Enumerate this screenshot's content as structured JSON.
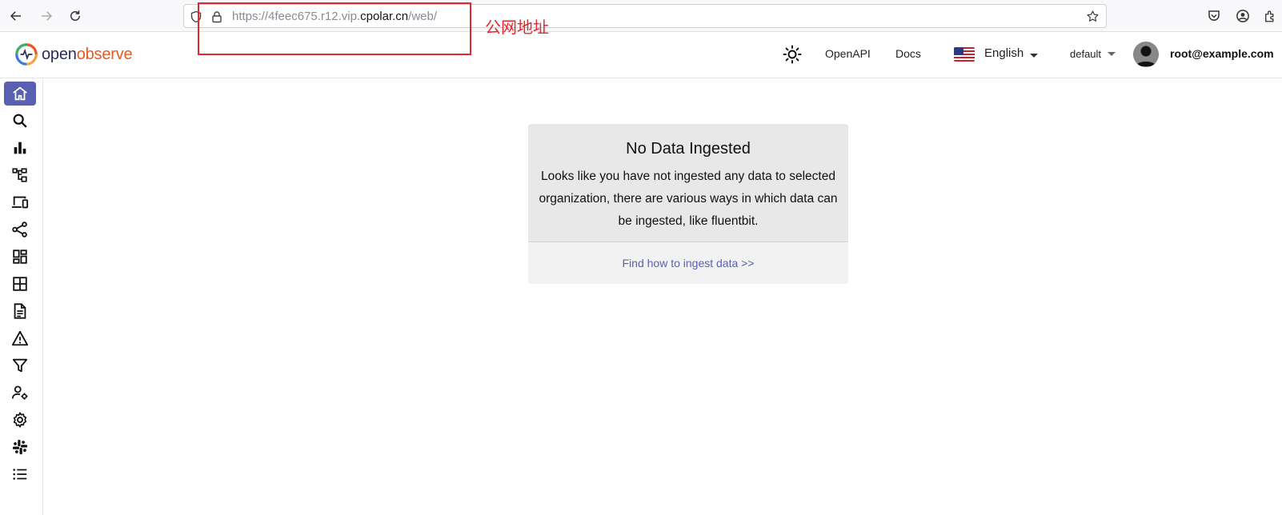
{
  "browser": {
    "url_prefix": "https://4feec675.r12.vip.",
    "url_domain": "cpolar.cn",
    "url_suffix": "/web/"
  },
  "annotation": {
    "label": "公网地址",
    "color": "#e5262d"
  },
  "header": {
    "logo_part1": "open",
    "logo_part2": "observe",
    "openapi_label": "OpenAPI",
    "docs_label": "Docs",
    "language": "English",
    "organization": "default",
    "user_email": "root@example.com"
  },
  "sidebar": {
    "items": [
      {
        "icon": "home-icon",
        "active": true
      },
      {
        "icon": "search-icon"
      },
      {
        "icon": "metrics-bar-chart-icon"
      },
      {
        "icon": "traces-icon"
      },
      {
        "icon": "rum-devices-icon"
      },
      {
        "icon": "pipelines-share-icon"
      },
      {
        "icon": "dashboards-icon"
      },
      {
        "icon": "streams-grid-icon"
      },
      {
        "icon": "reports-document-icon"
      },
      {
        "icon": "alerts-warning-icon"
      },
      {
        "icon": "ingestion-filter-icon"
      },
      {
        "icon": "iam-user-settings-icon"
      },
      {
        "icon": "settings-gear-icon"
      },
      {
        "icon": "slack-icon"
      },
      {
        "icon": "about-list-icon"
      }
    ],
    "accent": "#5960b2"
  },
  "main": {
    "title": "No Data Ingested",
    "message_line1": "Looks like you have not ingested any data to selected",
    "message_line2": "organization, there are various ways in which data can",
    "message_line3": "be ingested, like fluentbit.",
    "link_text": "Find how to ingest data >>"
  }
}
